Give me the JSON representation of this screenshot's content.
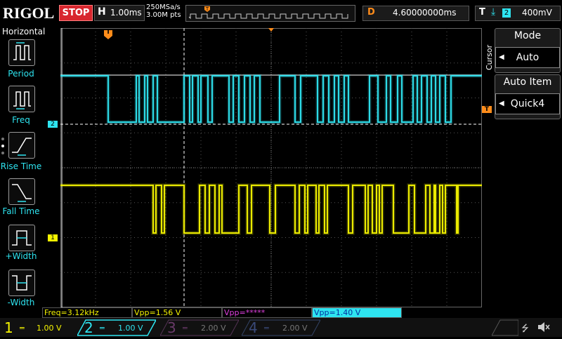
{
  "header": {
    "brand": "RIGOL",
    "run_state": "STOP",
    "timebase_label": "H",
    "timebase_value": "1.00ms",
    "sample_rate": "250MSa/s",
    "memory_depth": "3.00M pts",
    "trigger_marker": "T",
    "delay_label": "D",
    "delay_value": "4.60000000ms",
    "trigger_label": "T",
    "trigger_slope": "⤓",
    "trigger_source": "2",
    "trigger_level": "400mV"
  },
  "left_panel": {
    "title": "Horizontal",
    "buttons": [
      {
        "label": "Period",
        "icon": "period-icon"
      },
      {
        "label": "Freq",
        "icon": "freq-icon"
      },
      {
        "label": "Rise Time",
        "icon": "rise-time-icon"
      },
      {
        "label": "Fall Time",
        "icon": "fall-time-icon"
      },
      {
        "label": "+Width",
        "icon": "pos-width-icon"
      },
      {
        "label": "-Width",
        "icon": "neg-width-icon"
      }
    ]
  },
  "right_panel": {
    "section": "Cursor",
    "mode_title": "Mode",
    "mode_value": "Auto",
    "item_title": "Auto Item",
    "item_value": "Quick4"
  },
  "grid": {
    "trigger_pos_marker": "T",
    "ch2_marker": "2",
    "ch1_marker": "1",
    "trigger_level_marker": "T"
  },
  "measurements": [
    {
      "text": "Freq=3.12kHz",
      "color": "#f5f500"
    },
    {
      "text": "Vpp=1.56 V",
      "color": "#f5f500"
    },
    {
      "text": "Vpp=*****",
      "color": "#e040e0"
    },
    {
      "text": "Vpp=1.40 V",
      "color": "#2ee4f0"
    }
  ],
  "channels": [
    {
      "num": "1",
      "scale": "1.00 V",
      "color": "#f5f500"
    },
    {
      "num": "2",
      "scale": "1.00 V",
      "color": "#2ee4f0"
    },
    {
      "num": "3",
      "scale": "2.00 V",
      "color": "#6a3a6a"
    },
    {
      "num": "4",
      "scale": "2.00 V",
      "color": "#3a4a7a"
    }
  ],
  "status_icons": [
    "usb-icon",
    "speaker-mute-icon"
  ],
  "colors": {
    "ch1": "#f5f500",
    "ch2": "#2ee4f0",
    "accent": "#ff8c1a",
    "stop": "#d8262e"
  }
}
